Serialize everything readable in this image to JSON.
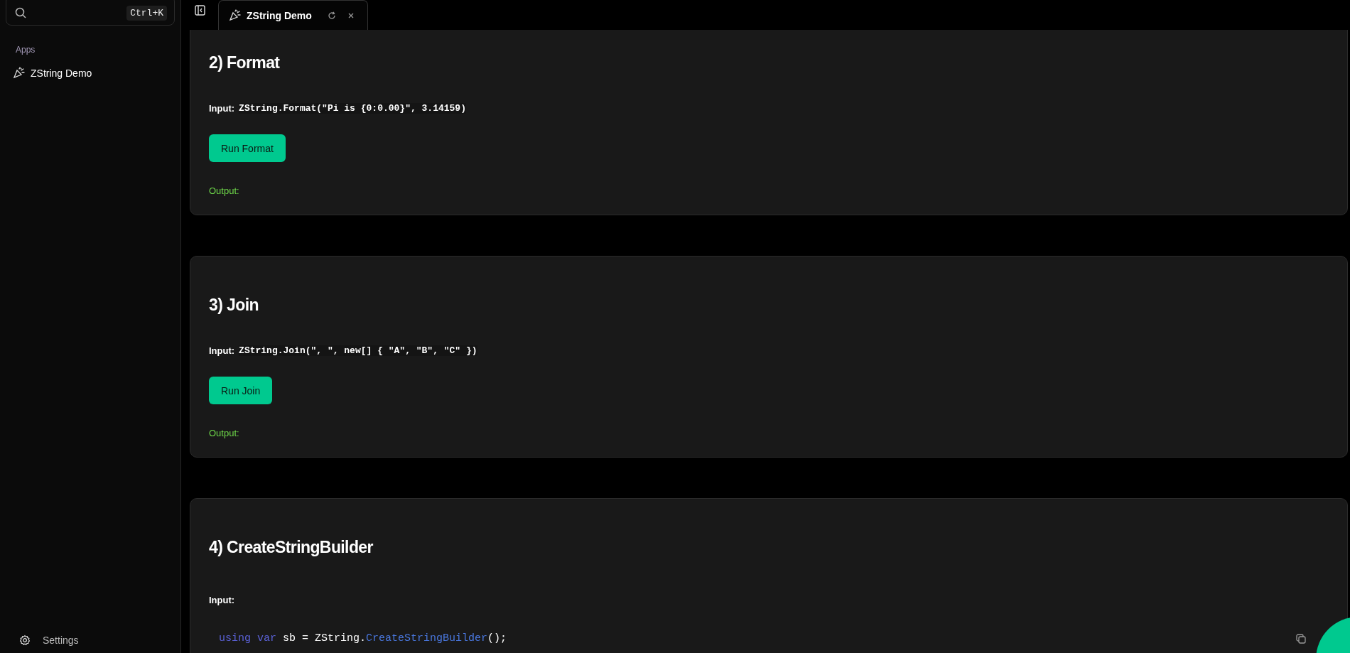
{
  "sidebar": {
    "search": {
      "shortcut": "Ctrl+K"
    },
    "section_label": "Apps",
    "items": [
      {
        "label": "ZString Demo"
      }
    ],
    "footer": {
      "label": "Settings"
    }
  },
  "tabs": [
    {
      "label": "ZString Demo",
      "selected": true
    }
  ],
  "cards": [
    {
      "kind": "inline",
      "title": "2) Format",
      "input_label": "Input:",
      "input_code": "ZString.Format(\"Pi is {0:0.00}\", 3.14159)",
      "button": "Run Format",
      "output_label": "Output:"
    },
    {
      "kind": "inline",
      "title": "3) Join",
      "input_label": "Input:",
      "input_code": "ZString.Join(\", \", new[] { \"A\", \"B\", \"C\" })",
      "button": "Run Join",
      "output_label": "Output:"
    },
    {
      "kind": "block",
      "title": "4) CreateStringBuilder",
      "input_label": "Input:",
      "code_lines": [
        [
          {
            "kind": "keyword",
            "text": "using var "
          },
          {
            "kind": "plain",
            "text": "sb = ZString."
          },
          {
            "kind": "method",
            "text": "CreateStringBuilder"
          },
          {
            "kind": "plain",
            "text": "();"
          }
        ]
      ]
    }
  ]
}
